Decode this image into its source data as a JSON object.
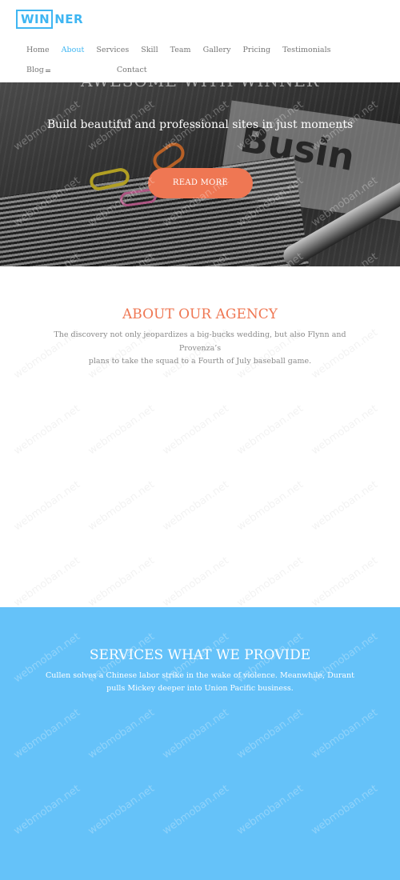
{
  "brand": {
    "logo_boxed": "WIN",
    "logo_rest": "NER",
    "accent_color": "#3fb6f2"
  },
  "nav": {
    "items": [
      {
        "label": "Home",
        "active": false
      },
      {
        "label": "About",
        "active": true
      },
      {
        "label": "Services",
        "active": false
      },
      {
        "label": "Skill",
        "active": false
      },
      {
        "label": "Team",
        "active": false
      },
      {
        "label": "Gallery",
        "active": false
      },
      {
        "label": "Pricing",
        "active": false
      },
      {
        "label": "Testimonials",
        "active": false
      },
      {
        "label": "Blog",
        "active": false,
        "icon": "menu-icon"
      },
      {
        "label": "Contact",
        "active": false
      }
    ]
  },
  "hero": {
    "ghost_heading": "AWESOME WITH WINNER",
    "background_word": "Busin",
    "tagline": "Build beautiful and professional sites in just moments",
    "button_label": "READ MORE",
    "button_color": "#ef7753"
  },
  "about": {
    "title": "ABOUT OUR AGENCY",
    "title_color": "#ef7753",
    "text_lines": [
      "The discovery not only jeopardizes a big-bucks wedding, but also Flynn and",
      "Provenza’s",
      "plans to take the squad to a Fourth of July baseball game."
    ]
  },
  "services": {
    "title": "SERVICES WHAT WE PROVIDE",
    "background_color": "#65c2f9",
    "text_lines": [
      "Cullen solves a Chinese labor strike in the wake of violence. Meanwhile, Durant",
      "pulls Mickey deeper into Union Pacific business."
    ]
  },
  "watermark": {
    "text": "webmoban.net"
  }
}
